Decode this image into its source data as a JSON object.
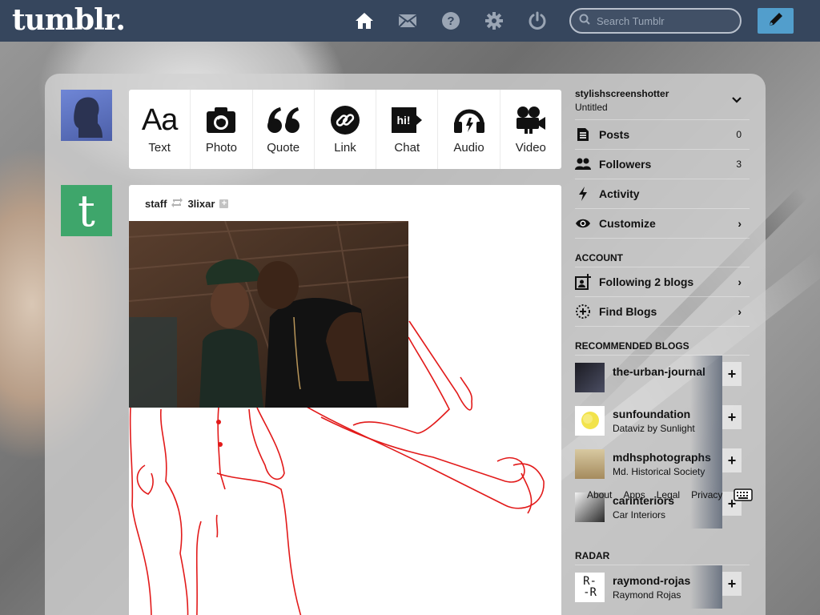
{
  "header": {
    "logo": "tumblr.",
    "nav": [
      {
        "icon": "home-icon"
      },
      {
        "icon": "mail-icon"
      },
      {
        "icon": "help-icon"
      },
      {
        "icon": "gear-icon"
      },
      {
        "icon": "power-icon"
      }
    ],
    "search_placeholder": "Search Tumblr",
    "compose_icon": "pencil-icon",
    "colors": {
      "bar": "#36465d",
      "compose": "#529ecc"
    }
  },
  "post_types": [
    {
      "label": "Text",
      "icon": "text-icon"
    },
    {
      "label": "Photo",
      "icon": "camera-icon"
    },
    {
      "label": "Quote",
      "icon": "quote-icon"
    },
    {
      "label": "Link",
      "icon": "link-icon"
    },
    {
      "label": "Chat",
      "icon": "chat-icon"
    },
    {
      "label": "Audio",
      "icon": "headphones-icon"
    },
    {
      "label": "Video",
      "icon": "video-camera-icon"
    }
  ],
  "post": {
    "author": "staff",
    "reblogged_from": "3lixar"
  },
  "sidebar": {
    "account_name": "stylishscreenshotter",
    "blog_title": "Untitled",
    "rows": [
      {
        "label": "Posts",
        "count": "0",
        "icon": "posts-icon"
      },
      {
        "label": "Followers",
        "count": "3",
        "icon": "followers-icon"
      },
      {
        "label": "Activity",
        "icon": "activity-icon"
      },
      {
        "label": "Customize",
        "icon": "eye-icon"
      }
    ],
    "account_section": "ACCOUNT",
    "account_rows": [
      {
        "label": "Following 2 blogs",
        "icon": "following-icon"
      },
      {
        "label": "Find Blogs",
        "icon": "find-blogs-icon"
      }
    ],
    "recommended_title": "RECOMMENDED BLOGS",
    "recommended": [
      {
        "name": "the-urban-journal",
        "sub": ""
      },
      {
        "name": "sunfoundation",
        "sub": "Dataviz by Sunlight"
      },
      {
        "name": "mdhsphotographs",
        "sub": "Md. Historical Society"
      },
      {
        "name": "carinteriors",
        "sub": "Car Interiors"
      }
    ],
    "radar_title": "RADAR",
    "radar": [
      {
        "name": "raymond-rojas",
        "sub": "Raymond Rojas"
      }
    ],
    "footer_links": [
      "About",
      "Apps",
      "Legal",
      "Privacy"
    ]
  }
}
